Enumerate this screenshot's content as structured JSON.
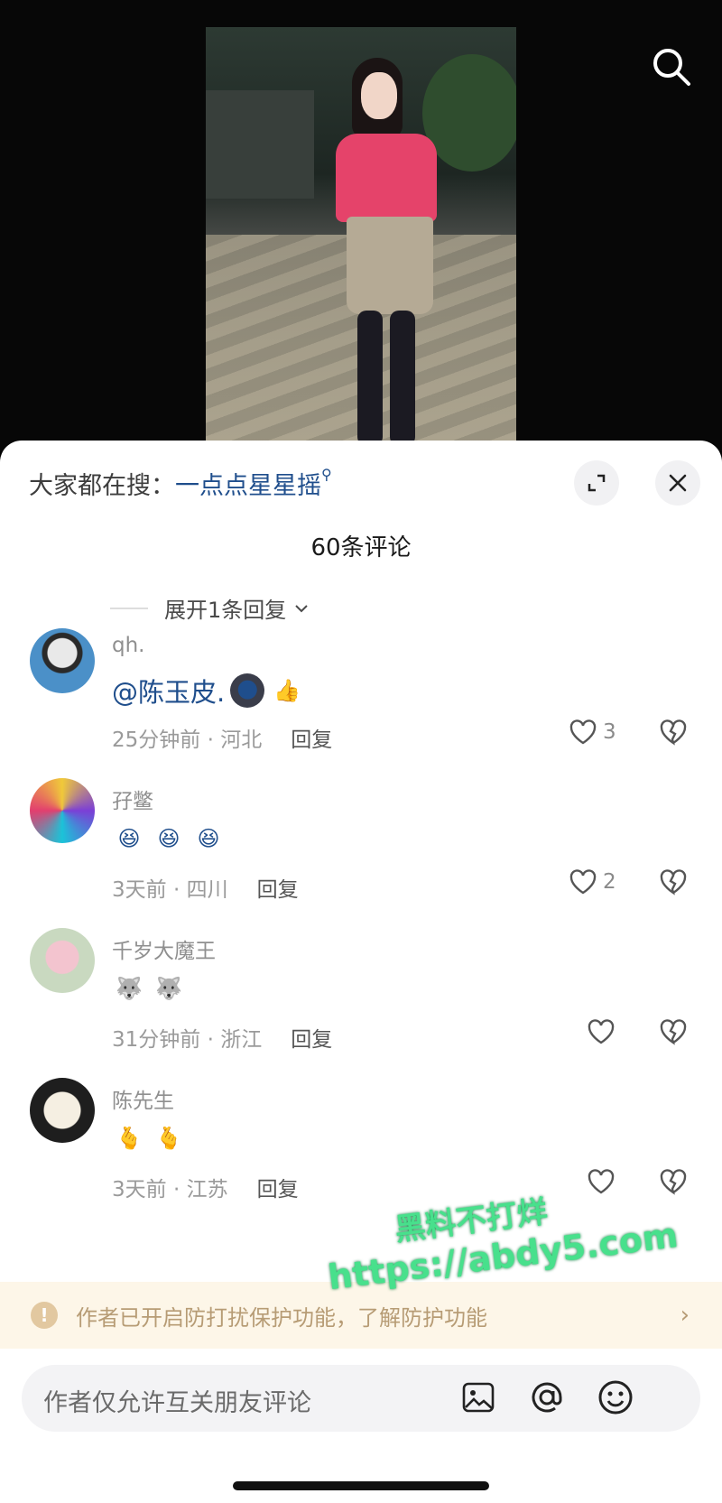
{
  "hot_search": {
    "prefix": "大家都在搜：",
    "keyword": "一点点星星摇"
  },
  "comment_count": "60条评论",
  "expand_replies": "展开1条回复",
  "comments": [
    {
      "username": "qh.",
      "text": "@陈玉皮.",
      "emojis": [
        "🌑",
        "👍"
      ],
      "time_location": "25分钟前 · 河北",
      "reply": "回复",
      "likes": "3"
    },
    {
      "username": "孖鳖",
      "text": "",
      "emojis": [
        "😆",
        "😆",
        "😆"
      ],
      "time_location": "3天前 · 四川",
      "reply": "回复",
      "likes": "2"
    },
    {
      "username": "千岁大魔王",
      "text": "",
      "emojis": [
        "🐺",
        "🐺"
      ],
      "time_location": "31分钟前 · 浙江",
      "reply": "回复",
      "likes": ""
    },
    {
      "username": "陈先生",
      "text": "",
      "emojis": [
        "🫰",
        "🫰"
      ],
      "time_location": "3天前 · 江苏",
      "reply": "回复",
      "likes": ""
    }
  ],
  "notice": {
    "text": "作者已开启防打扰保护功能，了解防护功能"
  },
  "input": {
    "placeholder": "作者仅允许互关朋友评论"
  },
  "watermark": {
    "line1": "黑料不打烊",
    "line2": "https://abdy5.com"
  },
  "colors": {
    "link_blue": "#1f4e8c",
    "notice_bg": "#fdf6e8",
    "notice_text": "#b79c75",
    "watermark_green": "#48e08c"
  }
}
